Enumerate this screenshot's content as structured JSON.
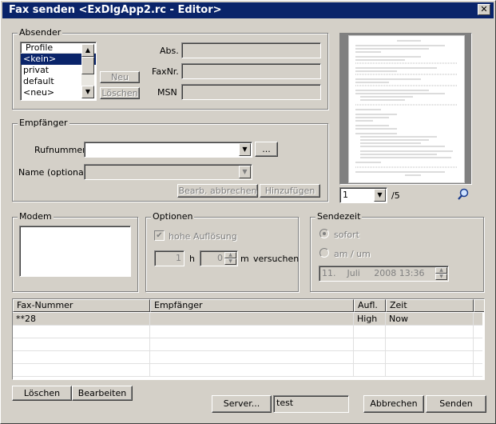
{
  "window": {
    "title": "Fax senden <ExDlgApp2.rc - Editor>",
    "close": "✕"
  },
  "absender": {
    "legend": "Absender",
    "profiles_header": "Profile",
    "profiles": [
      "<kein>",
      "privat",
      "default",
      "<neu>"
    ],
    "selected_profile": "<kein>",
    "new_label": "Neu",
    "delete_label": "Löschen",
    "abs_label": "Abs.",
    "abs_value": "",
    "faxnr_label": "FaxNr.",
    "faxnr_value": "",
    "msn_label": "MSN",
    "msn_value": ""
  },
  "preview": {
    "page_value": "1",
    "page_total": "/5",
    "zoom_icon": "magnifier-icon"
  },
  "empfaenger": {
    "legend": "Empfänger",
    "rufnummer_label": "Rufnummer",
    "rufnummer_value": "",
    "browse_label": "...",
    "name_label": "Name (optional)",
    "name_value": "",
    "cancel_edit_label": "Bearb. abbrechen",
    "add_label": "Hinzufügen"
  },
  "modem": {
    "legend": "Modem"
  },
  "optionen": {
    "legend": "Optionen",
    "hires_label": "hohe Auflösung",
    "hires_checked": true,
    "hours_value": "1",
    "hours_unit": "h",
    "minutes_value": "0",
    "minutes_unit": "m",
    "retry_label": "versuchen"
  },
  "sendezeit": {
    "legend": "Sendezeit",
    "sofort_label": "sofort",
    "am_um_label": "am / um",
    "datetime_value": "11.    Juli     2008 13:36"
  },
  "table": {
    "columns": [
      "Fax-Nummer",
      "Empfänger",
      "Aufl.",
      "Zeit"
    ],
    "rows": [
      {
        "fax": "**28",
        "empfaenger": "",
        "aufl": "High",
        "zeit": "Now"
      }
    ]
  },
  "footer": {
    "delete_label": "Löschen",
    "edit_label": "Bearbeiten",
    "server_label": "Server...",
    "server_value": "test",
    "cancel_label": "Abbrechen",
    "send_label": "Senden"
  },
  "colors": {
    "titlebar": "#0a246a",
    "face": "#d4d0c8",
    "selection": "#0a246a"
  }
}
